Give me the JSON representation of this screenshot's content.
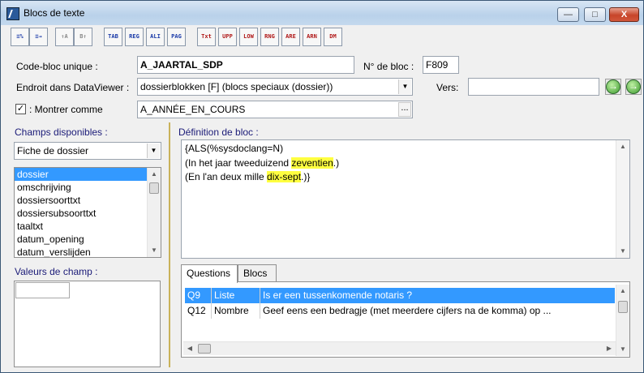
{
  "window": {
    "title": "Blocs de texte",
    "controls": {
      "minimize": "—",
      "maximize": "□",
      "close": "X"
    }
  },
  "toolbar": {
    "buttons": [
      {
        "name": "insert-tool",
        "label": "≡%",
        "color": "blue"
      },
      {
        "name": "export-tool",
        "label": "≡→",
        "color": "blue"
      },
      {
        "name": "sort-up-tool",
        "label": "↑A",
        "color": "gray"
      },
      {
        "name": "sort-down-tool",
        "label": "B↑",
        "color": "gray"
      },
      {
        "name": "tab-tool",
        "label": "TAB",
        "color": "blue"
      },
      {
        "name": "reg-tool",
        "label": "REG",
        "color": "blue"
      },
      {
        "name": "ali-tool",
        "label": "ALI",
        "color": "blue"
      },
      {
        "name": "pag-tool",
        "label": "PAG",
        "color": "blue"
      },
      {
        "name": "txt-tool",
        "label": "Txt",
        "color": "red"
      },
      {
        "name": "upp-tool",
        "label": "UPP",
        "color": "red"
      },
      {
        "name": "low-tool",
        "label": "LOW",
        "color": "red"
      },
      {
        "name": "rng-tool",
        "label": "RNG",
        "color": "red"
      },
      {
        "name": "are-tool",
        "label": "ARE",
        "color": "red"
      },
      {
        "name": "arn-tool",
        "label": "ARN",
        "color": "red"
      },
      {
        "name": "dm-tool",
        "label": "DM",
        "color": "red"
      }
    ]
  },
  "form": {
    "code_label": "Code-bloc unique :",
    "code_value": "A_JAARTAL_SDP",
    "bloc_no_label": "N° de bloc :",
    "bloc_no_value": "F809",
    "endroit_label": "Endroit dans DataViewer :",
    "endroit_value": "dossierblokken [F] (blocs speciaux (dossier))",
    "vers_label": "Vers:",
    "vers_value": "",
    "montrer_label": ": Montrer comme",
    "montrer_checked": "✓",
    "montrer_value": "A_ANNÉE_EN_COURS",
    "dots": "..."
  },
  "champs": {
    "label": "Champs disponibles :",
    "selected": "Fiche de dossier",
    "items": [
      "dossier",
      "omschrijving",
      "dossiersoorttxt",
      "dossiersubsoorttxt",
      "taaltxt",
      "datum_opening",
      "datum_verslijden"
    ]
  },
  "valeurs": {
    "label": "Valeurs de champ :"
  },
  "definition": {
    "label": "Définition de bloc :",
    "line1": "{ALS(%sysdoclang=N)",
    "line2_pre": "(In het jaar tweeduizend ",
    "line2_hl": "zeventien",
    "line2_post": ".)",
    "line3_pre": "(En l'an deux mille ",
    "line3_hl": "dix-sept",
    "line3_post": ".)}"
  },
  "tabs": [
    {
      "label": "Questions"
    },
    {
      "label": "Blocs"
    }
  ],
  "questions": [
    {
      "id": "Q9",
      "type": "Liste",
      "text": "Is er een tussenkomende notaris ?"
    },
    {
      "id": "Q12",
      "type": "Nombre",
      "text": "Geef eens een bedragje (met meerdere cijfers na de komma) op ..."
    }
  ],
  "colors": {
    "accent": "#3399ff",
    "highlight": "#ffff40",
    "label_blue": "#1b1b78"
  }
}
